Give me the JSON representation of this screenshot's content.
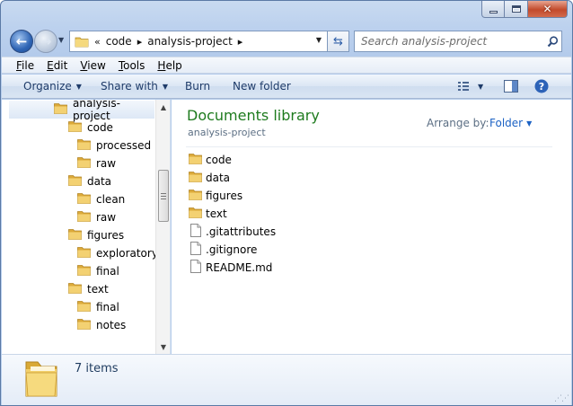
{
  "window": {
    "caption": {
      "minimize": "minimize",
      "maximize": "maximize",
      "close": "✕"
    }
  },
  "nav": {
    "address_prefix": "«",
    "crumbs": [
      "code",
      "analysis-project"
    ],
    "search_placeholder": "Search analysis-project"
  },
  "menu": [
    "File",
    "Edit",
    "View",
    "Tools",
    "Help"
  ],
  "menu_mnemonics": [
    "F",
    "E",
    "V",
    "T",
    "H"
  ],
  "toolbar": {
    "organize": "Organize",
    "share_with": "Share with",
    "burn": "Burn",
    "new_folder": "New folder"
  },
  "tree": [
    {
      "label": "analysis-project",
      "level": 0,
      "selected": true
    },
    {
      "label": "code",
      "level": 1
    },
    {
      "label": "processed",
      "level": 2
    },
    {
      "label": "raw",
      "level": 2
    },
    {
      "label": "data",
      "level": 1
    },
    {
      "label": "clean",
      "level": 2
    },
    {
      "label": "raw",
      "level": 2
    },
    {
      "label": "figures",
      "level": 1
    },
    {
      "label": "exploratory",
      "level": 2
    },
    {
      "label": "final",
      "level": 2
    },
    {
      "label": "text",
      "level": 1
    },
    {
      "label": "final",
      "level": 2
    },
    {
      "label": "notes",
      "level": 2
    }
  ],
  "library": {
    "title": "Documents library",
    "subtitle": "analysis-project",
    "arrange_label": "Arrange by:",
    "arrange_value": "Folder"
  },
  "files": [
    {
      "name": "code",
      "type": "folder"
    },
    {
      "name": "data",
      "type": "folder"
    },
    {
      "name": "figures",
      "type": "folder"
    },
    {
      "name": "text",
      "type": "folder"
    },
    {
      "name": ".gitattributes",
      "type": "file"
    },
    {
      "name": ".gitignore",
      "type": "file"
    },
    {
      "name": "README.md",
      "type": "file"
    }
  ],
  "details": {
    "count_text": "7 items"
  },
  "colors": {
    "library_title": "#1e7b1e",
    "link_blue": "#1c62c4",
    "folder": "#e8c35a"
  }
}
